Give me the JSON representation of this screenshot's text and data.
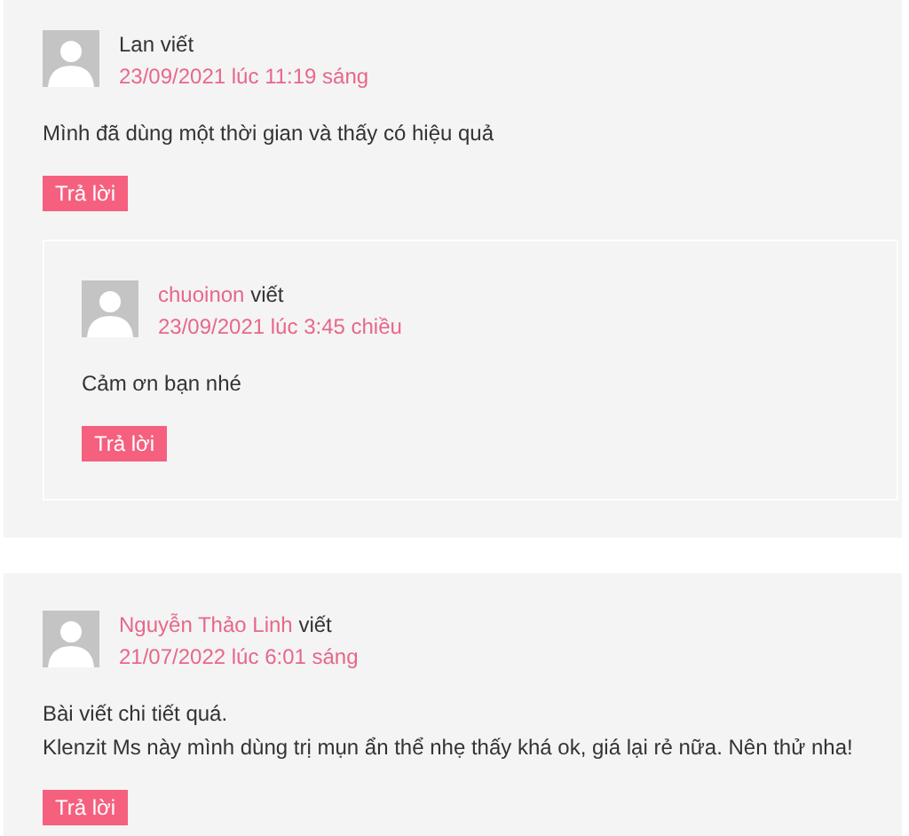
{
  "comments": [
    {
      "author": "Lan",
      "author_linked": false,
      "verb": "viết",
      "date": "23/09/2021 lúc 11:19 sáng",
      "paragraphs": [
        "Mình đã dùng một thời gian và thấy có hiệu quả"
      ],
      "reply_button": "Trả lời",
      "children": [
        {
          "author": "chuoinon",
          "author_linked": true,
          "verb": "viết",
          "date": "23/09/2021 lúc 3:45 chiều",
          "paragraphs": [
            "Cảm ơn bạn nhé"
          ],
          "reply_button": "Trả lời"
        }
      ]
    },
    {
      "author": "Nguyễn Thảo Linh",
      "author_linked": true,
      "verb": "viết",
      "date": "21/07/2022 lúc 6:01 sáng",
      "paragraphs": [
        "Bài viết chi tiết quá.",
        "Klenzit Ms này mình dùng trị mụn ẩn thể nhẹ thấy khá ok, giá lại rẻ nữa. Nên thử nha!"
      ],
      "reply_button": "Trả lời"
    }
  ]
}
